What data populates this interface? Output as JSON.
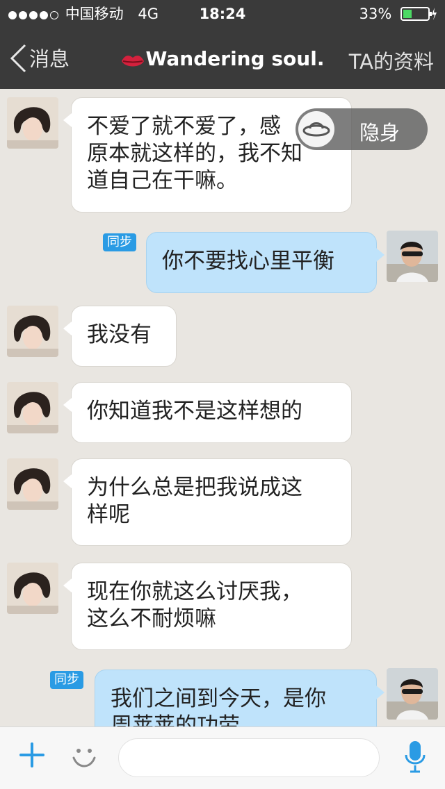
{
  "status": {
    "carrier": "中国移动",
    "network": "4G",
    "time": "18:24",
    "battery": "33%"
  },
  "nav": {
    "back_label": "消息",
    "title": "Wandering soul.",
    "profile_label": "TA的资料"
  },
  "stealth": {
    "label": "隐身"
  },
  "sync_badge": "同步",
  "messages": [
    {
      "side": "in",
      "text": "不爱了就不爱了，感\n原本就这样的，我不知\n道自己在干嘛。"
    },
    {
      "side": "out",
      "text": "你不要找心里平衡"
    },
    {
      "side": "in",
      "text": "我没有"
    },
    {
      "side": "in",
      "text": "你知道我不是这样想的"
    },
    {
      "side": "in",
      "text": "为什么总是把我说成这\n样呢"
    },
    {
      "side": "in",
      "text": "现在你就这么讨厌我，\n这么不耐烦嘛"
    },
    {
      "side": "out",
      "text": "我们之间到今天，是你\n周莱莱的功劳"
    }
  ],
  "input": {
    "placeholder": ""
  },
  "colors": {
    "nav_bg": "#3a3a3a",
    "chat_bg": "#e9e6e1",
    "incoming_bubble": "#ffffff",
    "outgoing_bubble": "#bfe3fb",
    "accent": "#2a9be4",
    "battery_green": "#4cd964"
  },
  "icons": {
    "back": "chevron-left-icon",
    "title": "lips-icon",
    "stealth": "ufo-icon",
    "plus": "plus-icon",
    "emoji": "smiley-icon",
    "mic": "microphone-icon"
  }
}
